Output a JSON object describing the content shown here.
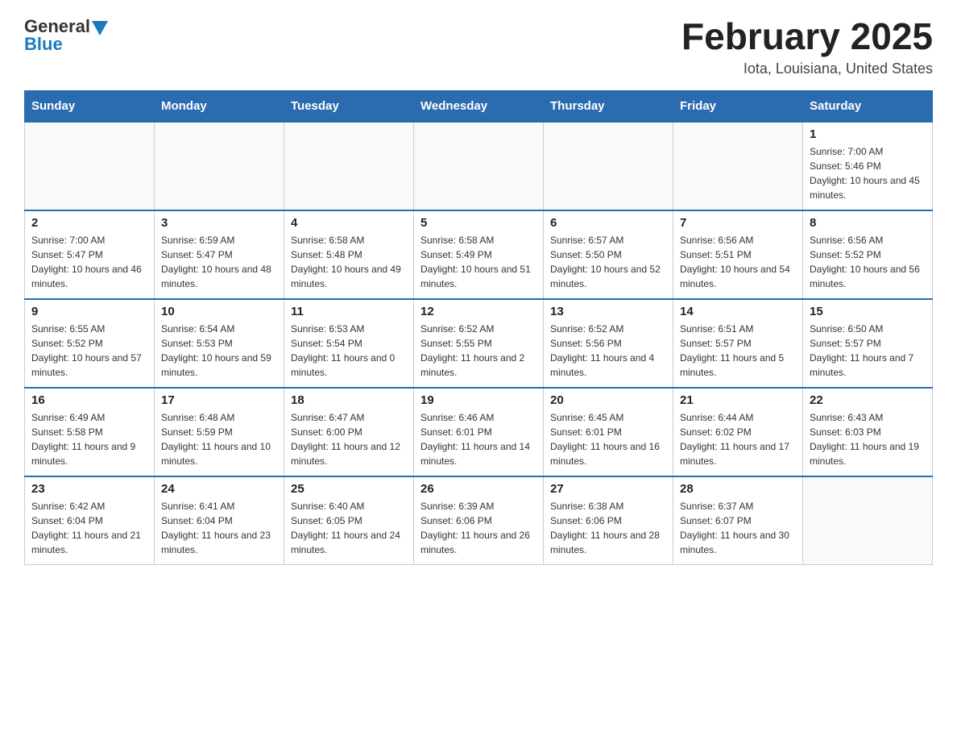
{
  "header": {
    "logo_general": "General",
    "logo_blue": "Blue",
    "title": "February 2025",
    "subtitle": "Iota, Louisiana, United States"
  },
  "days_of_week": [
    "Sunday",
    "Monday",
    "Tuesday",
    "Wednesday",
    "Thursday",
    "Friday",
    "Saturday"
  ],
  "weeks": [
    [
      {
        "day": "",
        "sunrise": "",
        "sunset": "",
        "daylight": "",
        "empty": true
      },
      {
        "day": "",
        "sunrise": "",
        "sunset": "",
        "daylight": "",
        "empty": true
      },
      {
        "day": "",
        "sunrise": "",
        "sunset": "",
        "daylight": "",
        "empty": true
      },
      {
        "day": "",
        "sunrise": "",
        "sunset": "",
        "daylight": "",
        "empty": true
      },
      {
        "day": "",
        "sunrise": "",
        "sunset": "",
        "daylight": "",
        "empty": true
      },
      {
        "day": "",
        "sunrise": "",
        "sunset": "",
        "daylight": "",
        "empty": true
      },
      {
        "day": "1",
        "sunrise": "Sunrise: 7:00 AM",
        "sunset": "Sunset: 5:46 PM",
        "daylight": "Daylight: 10 hours and 45 minutes.",
        "empty": false
      }
    ],
    [
      {
        "day": "2",
        "sunrise": "Sunrise: 7:00 AM",
        "sunset": "Sunset: 5:47 PM",
        "daylight": "Daylight: 10 hours and 46 minutes.",
        "empty": false
      },
      {
        "day": "3",
        "sunrise": "Sunrise: 6:59 AM",
        "sunset": "Sunset: 5:47 PM",
        "daylight": "Daylight: 10 hours and 48 minutes.",
        "empty": false
      },
      {
        "day": "4",
        "sunrise": "Sunrise: 6:58 AM",
        "sunset": "Sunset: 5:48 PM",
        "daylight": "Daylight: 10 hours and 49 minutes.",
        "empty": false
      },
      {
        "day": "5",
        "sunrise": "Sunrise: 6:58 AM",
        "sunset": "Sunset: 5:49 PM",
        "daylight": "Daylight: 10 hours and 51 minutes.",
        "empty": false
      },
      {
        "day": "6",
        "sunrise": "Sunrise: 6:57 AM",
        "sunset": "Sunset: 5:50 PM",
        "daylight": "Daylight: 10 hours and 52 minutes.",
        "empty": false
      },
      {
        "day": "7",
        "sunrise": "Sunrise: 6:56 AM",
        "sunset": "Sunset: 5:51 PM",
        "daylight": "Daylight: 10 hours and 54 minutes.",
        "empty": false
      },
      {
        "day": "8",
        "sunrise": "Sunrise: 6:56 AM",
        "sunset": "Sunset: 5:52 PM",
        "daylight": "Daylight: 10 hours and 56 minutes.",
        "empty": false
      }
    ],
    [
      {
        "day": "9",
        "sunrise": "Sunrise: 6:55 AM",
        "sunset": "Sunset: 5:52 PM",
        "daylight": "Daylight: 10 hours and 57 minutes.",
        "empty": false
      },
      {
        "day": "10",
        "sunrise": "Sunrise: 6:54 AM",
        "sunset": "Sunset: 5:53 PM",
        "daylight": "Daylight: 10 hours and 59 minutes.",
        "empty": false
      },
      {
        "day": "11",
        "sunrise": "Sunrise: 6:53 AM",
        "sunset": "Sunset: 5:54 PM",
        "daylight": "Daylight: 11 hours and 0 minutes.",
        "empty": false
      },
      {
        "day": "12",
        "sunrise": "Sunrise: 6:52 AM",
        "sunset": "Sunset: 5:55 PM",
        "daylight": "Daylight: 11 hours and 2 minutes.",
        "empty": false
      },
      {
        "day": "13",
        "sunrise": "Sunrise: 6:52 AM",
        "sunset": "Sunset: 5:56 PM",
        "daylight": "Daylight: 11 hours and 4 minutes.",
        "empty": false
      },
      {
        "day": "14",
        "sunrise": "Sunrise: 6:51 AM",
        "sunset": "Sunset: 5:57 PM",
        "daylight": "Daylight: 11 hours and 5 minutes.",
        "empty": false
      },
      {
        "day": "15",
        "sunrise": "Sunrise: 6:50 AM",
        "sunset": "Sunset: 5:57 PM",
        "daylight": "Daylight: 11 hours and 7 minutes.",
        "empty": false
      }
    ],
    [
      {
        "day": "16",
        "sunrise": "Sunrise: 6:49 AM",
        "sunset": "Sunset: 5:58 PM",
        "daylight": "Daylight: 11 hours and 9 minutes.",
        "empty": false
      },
      {
        "day": "17",
        "sunrise": "Sunrise: 6:48 AM",
        "sunset": "Sunset: 5:59 PM",
        "daylight": "Daylight: 11 hours and 10 minutes.",
        "empty": false
      },
      {
        "day": "18",
        "sunrise": "Sunrise: 6:47 AM",
        "sunset": "Sunset: 6:00 PM",
        "daylight": "Daylight: 11 hours and 12 minutes.",
        "empty": false
      },
      {
        "day": "19",
        "sunrise": "Sunrise: 6:46 AM",
        "sunset": "Sunset: 6:01 PM",
        "daylight": "Daylight: 11 hours and 14 minutes.",
        "empty": false
      },
      {
        "day": "20",
        "sunrise": "Sunrise: 6:45 AM",
        "sunset": "Sunset: 6:01 PM",
        "daylight": "Daylight: 11 hours and 16 minutes.",
        "empty": false
      },
      {
        "day": "21",
        "sunrise": "Sunrise: 6:44 AM",
        "sunset": "Sunset: 6:02 PM",
        "daylight": "Daylight: 11 hours and 17 minutes.",
        "empty": false
      },
      {
        "day": "22",
        "sunrise": "Sunrise: 6:43 AM",
        "sunset": "Sunset: 6:03 PM",
        "daylight": "Daylight: 11 hours and 19 minutes.",
        "empty": false
      }
    ],
    [
      {
        "day": "23",
        "sunrise": "Sunrise: 6:42 AM",
        "sunset": "Sunset: 6:04 PM",
        "daylight": "Daylight: 11 hours and 21 minutes.",
        "empty": false
      },
      {
        "day": "24",
        "sunrise": "Sunrise: 6:41 AM",
        "sunset": "Sunset: 6:04 PM",
        "daylight": "Daylight: 11 hours and 23 minutes.",
        "empty": false
      },
      {
        "day": "25",
        "sunrise": "Sunrise: 6:40 AM",
        "sunset": "Sunset: 6:05 PM",
        "daylight": "Daylight: 11 hours and 24 minutes.",
        "empty": false
      },
      {
        "day": "26",
        "sunrise": "Sunrise: 6:39 AM",
        "sunset": "Sunset: 6:06 PM",
        "daylight": "Daylight: 11 hours and 26 minutes.",
        "empty": false
      },
      {
        "day": "27",
        "sunrise": "Sunrise: 6:38 AM",
        "sunset": "Sunset: 6:06 PM",
        "daylight": "Daylight: 11 hours and 28 minutes.",
        "empty": false
      },
      {
        "day": "28",
        "sunrise": "Sunrise: 6:37 AM",
        "sunset": "Sunset: 6:07 PM",
        "daylight": "Daylight: 11 hours and 30 minutes.",
        "empty": false
      },
      {
        "day": "",
        "sunrise": "",
        "sunset": "",
        "daylight": "",
        "empty": true
      }
    ]
  ]
}
